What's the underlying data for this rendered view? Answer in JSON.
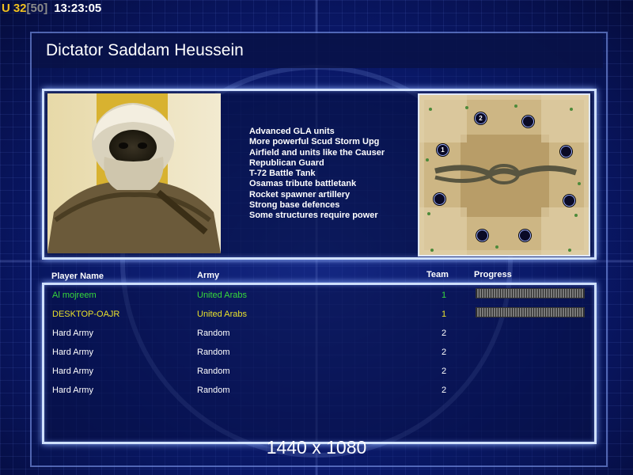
{
  "hud": {
    "prefix": "U",
    "level": "32",
    "max_level": "[50]",
    "time": "13:23:05"
  },
  "title": "Dictator Saddam Heussein",
  "features": [
    "Advanced GLA units",
    "More powerful Scud Storm Upg",
    "Airfield and units like the Causer",
    "Republican Guard",
    "T-72 Battle Tank",
    "Osamas tribute battletank",
    "Rocket spawner artillery",
    "Strong base defences",
    "Some structures require power"
  ],
  "minimap": {
    "markers": [
      "1",
      "2"
    ]
  },
  "table": {
    "headers": {
      "name": "Player Name",
      "army": "Army",
      "team": "Team",
      "progress": "Progress"
    },
    "players": [
      {
        "name": "Al mojreem",
        "army": "United Arabs",
        "team": "1",
        "color": "#37d93a",
        "progress": 1.0
      },
      {
        "name": "DESKTOP-OAJR",
        "army": "United Arabs",
        "team": "1",
        "color": "#e8e02c",
        "progress": 1.0
      },
      {
        "name": "Hard Army",
        "army": "Random",
        "team": "2",
        "color": "#ffffff"
      },
      {
        "name": "Hard Army",
        "army": "Random",
        "team": "2",
        "color": "#ffffff"
      },
      {
        "name": "Hard Army",
        "army": "Random",
        "team": "2",
        "color": "#ffffff"
      },
      {
        "name": "Hard Army",
        "army": "Random",
        "team": "2",
        "color": "#ffffff"
      }
    ]
  },
  "resolution": "1440 x 1080"
}
